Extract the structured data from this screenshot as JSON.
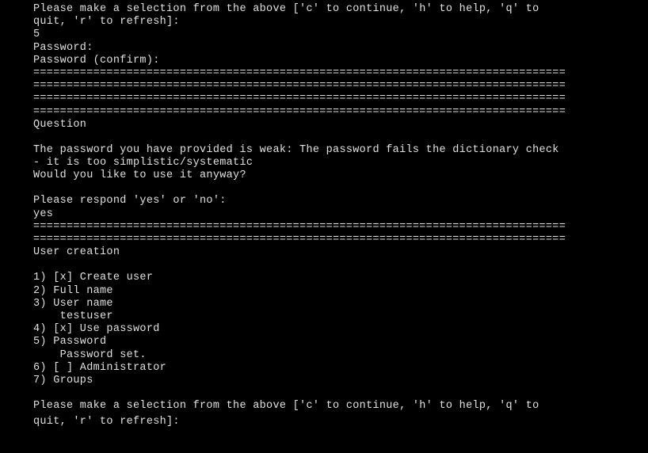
{
  "header": {
    "prompt_line1": "Please make a selection from the above ['c' to continue, 'h' to help, 'q' to",
    "prompt_line2": "quit, 'r' to refresh]:",
    "selection_response": "5",
    "password_prompt": "Password:",
    "password_confirm_prompt": "Password (confirm):"
  },
  "separator": "================================================================================",
  "question": {
    "heading": "Question",
    "body_line1": "The password you have provided is weak: The password fails the dictionary check",
    "body_line2": "- it is too simplistic/systematic",
    "body_line3": "Would you like to use it anyway?",
    "prompt": "Please respond 'yes' or 'no':",
    "response": "yes"
  },
  "user_creation": {
    "heading": "User creation",
    "items": [
      "1) [x] Create user",
      "2) Full name",
      "3) User name",
      "    testuser",
      "4) [x] Use password",
      "5) Password",
      "    Password set.",
      "6) [ ] Administrator",
      "7) Groups"
    ],
    "prompt_line1": "Please make a selection from the above ['c' to continue, 'h' to help, 'q' to",
    "prompt_line2": "quit, 'r' to refresh]:"
  }
}
